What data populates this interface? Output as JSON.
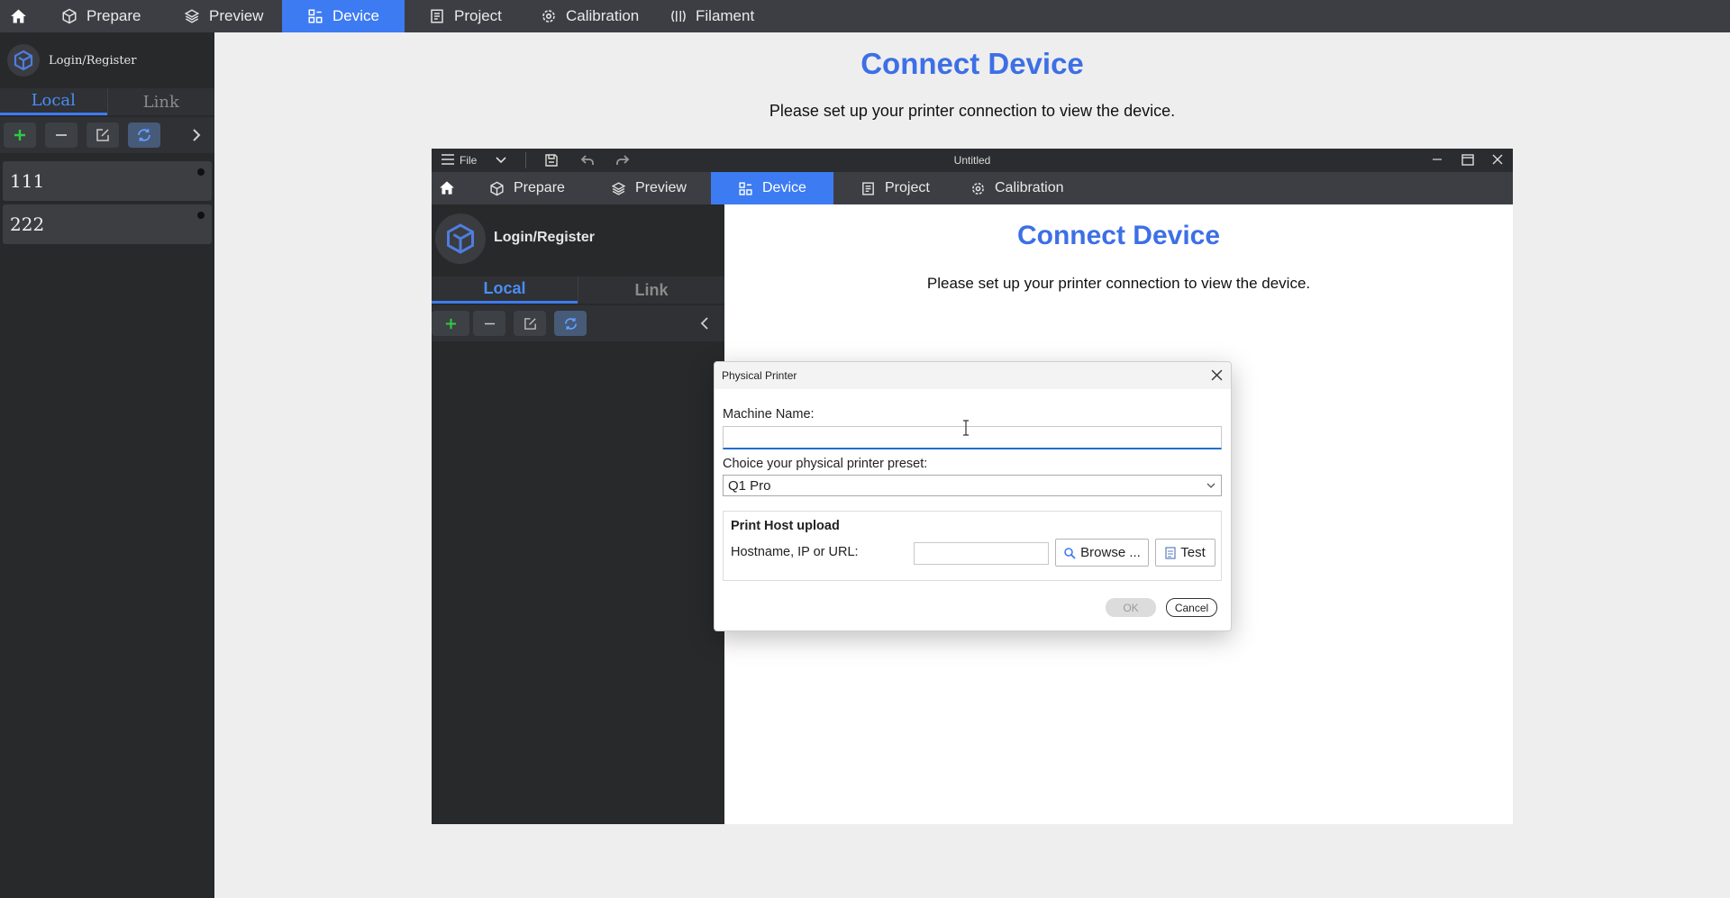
{
  "nav": {
    "tabs": [
      {
        "label": "Prepare",
        "icon": "cube-icon"
      },
      {
        "label": "Preview",
        "icon": "layers-icon"
      },
      {
        "label": "Device",
        "icon": "device-icon",
        "active": true
      },
      {
        "label": "Project",
        "icon": "project-icon"
      },
      {
        "label": "Calibration",
        "icon": "gear-icon"
      },
      {
        "label": "Filament",
        "icon": "filament-icon"
      }
    ]
  },
  "sidebar": {
    "login_label": "Login/Register",
    "tabs": {
      "local": "Local",
      "link": "Link"
    },
    "printers": [
      {
        "name": "111"
      },
      {
        "name": "222"
      }
    ]
  },
  "main": {
    "title": "Connect Device",
    "subtitle": "Please set up your printer connection to view the device."
  },
  "inner_window": {
    "title": "Untitled",
    "file_label": "File",
    "tabs": [
      "Prepare",
      "Preview",
      "Device",
      "Project",
      "Calibration"
    ],
    "login_label": "Login/Register",
    "local_tab": "Local",
    "link_tab": "Link",
    "main_title": "Connect Device",
    "main_subtitle": "Please set up your printer connection to view the device."
  },
  "dialog": {
    "title": "Physical Printer",
    "machine_name_label": "Machine Name:",
    "machine_name_value": "",
    "preset_label": "Choice your physical printer preset:",
    "preset_value": "Q1 Pro",
    "group_title": "Print Host upload",
    "host_label": "Hostname, IP or URL:",
    "host_value": "",
    "browse_label": "Browse ...",
    "test_label": "Test",
    "ok_label": "OK",
    "cancel_label": "Cancel"
  },
  "colors": {
    "accent": "#3d7bf2",
    "title_blue": "#3d6fe6",
    "add_green": "#2ecc40"
  }
}
